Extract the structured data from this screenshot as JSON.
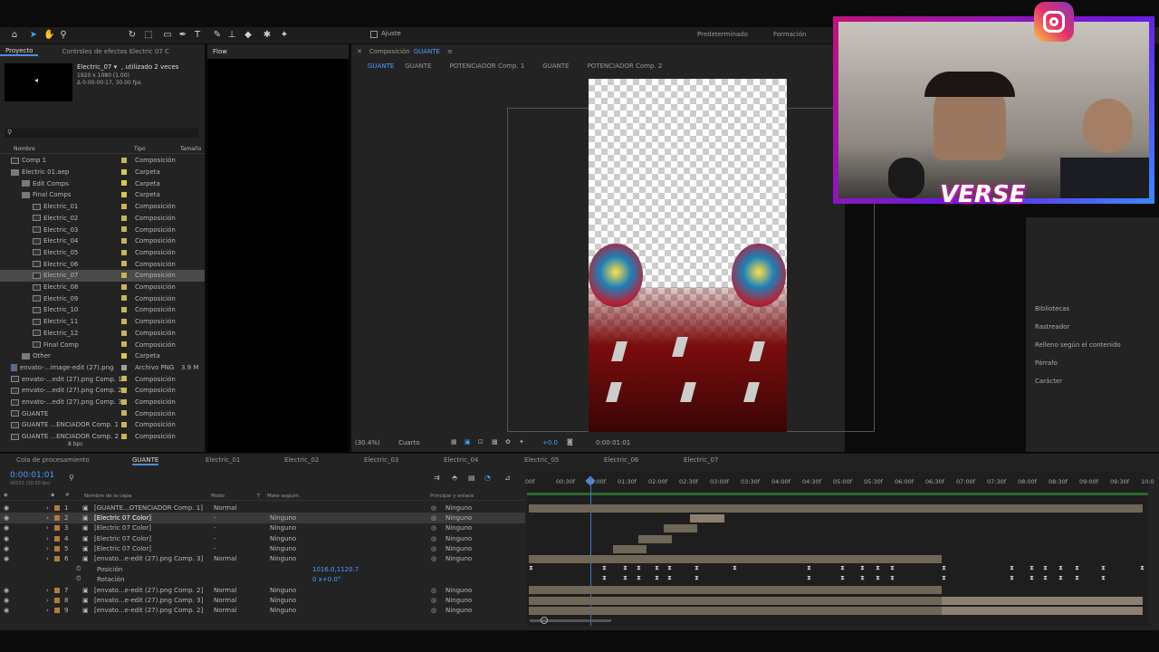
{
  "toolbar": {
    "ajuste_label": "Ajuste",
    "workspace1": "Predeterminado",
    "workspace2": "Formación"
  },
  "project_panel": {
    "tabs": [
      "Proyecto",
      "Controles de efectos Electric 07 C"
    ],
    "flow_tab": "Flow",
    "item_name": "Electric_07 ▾",
    "item_usage": ", utilizado 2 veces",
    "item_dims": "1920 x 1080 (1.00)",
    "item_duration": "Δ 0:00:00:17, 30.00 fps",
    "columns": {
      "name": "Nombre",
      "type": "Tipo",
      "size": "Tamaño"
    },
    "bpc": "8 bpc",
    "rows": [
      {
        "name": "Comp 1",
        "type": "Composición",
        "size": "",
        "icon": "comp",
        "indent": 0,
        "color": "#c8b45a"
      },
      {
        "name": "Electric 01.aep",
        "type": "Carpeta",
        "size": "",
        "icon": "folder",
        "indent": 0,
        "color": "#d6c84a"
      },
      {
        "name": "Edit Comps",
        "type": "Carpeta",
        "size": "",
        "icon": "folder",
        "indent": 1,
        "color": "#d6c84a"
      },
      {
        "name": "Final Comps",
        "type": "Carpeta",
        "size": "",
        "icon": "folder",
        "indent": 1,
        "color": "#d6c84a"
      },
      {
        "name": "Electric_01",
        "type": "Composición",
        "size": "",
        "icon": "comp",
        "indent": 2,
        "color": "#c8b45a"
      },
      {
        "name": "Electric_02",
        "type": "Composición",
        "size": "",
        "icon": "comp",
        "indent": 2,
        "color": "#c8b45a"
      },
      {
        "name": "Electric_03",
        "type": "Composición",
        "size": "",
        "icon": "comp",
        "indent": 2,
        "color": "#c8b45a"
      },
      {
        "name": "Electric_04",
        "type": "Composición",
        "size": "",
        "icon": "comp",
        "indent": 2,
        "color": "#c8b45a"
      },
      {
        "name": "Electric_05",
        "type": "Composición",
        "size": "",
        "icon": "comp",
        "indent": 2,
        "color": "#c8b45a"
      },
      {
        "name": "Electric_06",
        "type": "Composición",
        "size": "",
        "icon": "comp",
        "indent": 2,
        "color": "#c8b45a"
      },
      {
        "name": "Electric_07",
        "type": "Composición",
        "size": "",
        "icon": "comp",
        "indent": 2,
        "color": "#c8b45a",
        "selected": true
      },
      {
        "name": "Electric_08",
        "type": "Composición",
        "size": "",
        "icon": "comp",
        "indent": 2,
        "color": "#c8b45a"
      },
      {
        "name": "Electric_09",
        "type": "Composición",
        "size": "",
        "icon": "comp",
        "indent": 2,
        "color": "#c8b45a"
      },
      {
        "name": "Electric_10",
        "type": "Composición",
        "size": "",
        "icon": "comp",
        "indent": 2,
        "color": "#c8b45a"
      },
      {
        "name": "Electric_11",
        "type": "Composición",
        "size": "",
        "icon": "comp",
        "indent": 2,
        "color": "#c8b45a"
      },
      {
        "name": "Electric_12",
        "type": "Composición",
        "size": "",
        "icon": "comp",
        "indent": 2,
        "color": "#c8b45a"
      },
      {
        "name": "Final Comp",
        "type": "Composición",
        "size": "",
        "icon": "comp",
        "indent": 2,
        "color": "#c8b45a"
      },
      {
        "name": "Other",
        "type": "Carpeta",
        "size": "",
        "icon": "folder",
        "indent": 1,
        "color": "#d6c84a"
      },
      {
        "name": "envato-...image-edit (27).png",
        "type": "Archivo PNG",
        "size": "3.9 M",
        "icon": "png",
        "indent": 0,
        "color": "#a0a0a0"
      },
      {
        "name": "envato-...edit (27).png Comp. 1",
        "type": "Composición",
        "size": "",
        "icon": "comp",
        "indent": 0,
        "color": "#c8b45a"
      },
      {
        "name": "envato-...edit (27).png Comp. 2",
        "type": "Composición",
        "size": "",
        "icon": "comp",
        "indent": 0,
        "color": "#c8b45a"
      },
      {
        "name": "envato-...edit (27).png Comp. 3",
        "type": "Composición",
        "size": "",
        "icon": "comp",
        "indent": 0,
        "color": "#c8b45a"
      },
      {
        "name": "GUANTE",
        "type": "Composición",
        "size": "",
        "icon": "comp",
        "indent": 0,
        "color": "#c8b45a"
      },
      {
        "name": "GUANTE ...ENCIADOR Comp. 1",
        "type": "Composición",
        "size": "",
        "icon": "comp",
        "indent": 0,
        "color": "#c8b45a"
      },
      {
        "name": "GUANTE ...ENCIADOR Comp. 2",
        "type": "Composición",
        "size": "",
        "icon": "comp",
        "indent": 0,
        "color": "#c8b45a"
      }
    ]
  },
  "composition": {
    "header_prefix": "Composición",
    "header_name": "GUANTE",
    "breadcrumbs": [
      "GUANTE",
      "GUANTE",
      "POTENCIADOR Comp. 1",
      "GUANTE",
      "POTENCIADOR Comp. 2"
    ],
    "zoom": "(30.4%)",
    "resolution": "Cuarto",
    "exposure": "+0.0",
    "timecode": "0:00:01:01"
  },
  "right_panel": {
    "items": [
      "Bibliotecas",
      "Rastreador",
      "Relleno según el contenido",
      "Párrafo",
      "Carácter"
    ]
  },
  "webcam": {
    "overlay_text": "VERSE"
  },
  "timeline": {
    "tabs": [
      "Cola de procesamiento",
      "GUANTE",
      "Electric_01",
      "Electric_02",
      "Electric_03",
      "Electric_04",
      "Electric_05",
      "Electric_06",
      "Electric_07"
    ],
    "timecode": "0:00:01:01",
    "subtime": "00031 (30.00 fps)",
    "columns": {
      "layer_name": "Nombre de la capa",
      "mode": "Modo",
      "t": "T",
      "matte": "Mate seguim.",
      "parent": "Principal y enlace"
    },
    "ruler": [
      "00f",
      "00:30f",
      "01:00f",
      "01:30f",
      "02:00f",
      "02:30f",
      "03:00f",
      "03:30f",
      "04:00f",
      "04:30f",
      "05:00f",
      "05:30f",
      "06:00f",
      "06:30f",
      "07:00f",
      "07:30f",
      "08:00f",
      "08:30f",
      "09:00f",
      "09:30f",
      "10:0"
    ],
    "layers": [
      {
        "num": "1",
        "name": "[GUANTE...OTENCIADOR Comp. 1]",
        "mode": "Normal",
        "matte": "",
        "parent": "Ninguno"
      },
      {
        "num": "2",
        "name": "[Electric 07 Color]",
        "mode": "-",
        "matte": "Ninguno",
        "parent": "Ninguno",
        "selected": true
      },
      {
        "num": "3",
        "name": "[Electric 07 Color]",
        "mode": "-",
        "matte": "Ninguno",
        "parent": "Ninguno"
      },
      {
        "num": "4",
        "name": "[Electric 07 Color]",
        "mode": "-",
        "matte": "Ninguno",
        "parent": "Ninguno"
      },
      {
        "num": "5",
        "name": "[Electric 07 Color]",
        "mode": "-",
        "matte": "Ninguno",
        "parent": "Ninguno"
      },
      {
        "num": "6",
        "name": "[envato...e-edit (27).png Comp. 3]",
        "mode": "Normal",
        "matte": "Ninguno",
        "parent": "Ninguno"
      }
    ],
    "props": [
      {
        "name": "Posición",
        "value": "1016.0,1120.7"
      },
      {
        "name": "Rotación",
        "value": "0 x+0.0°"
      }
    ],
    "layers2": [
      {
        "num": "7",
        "name": "[envato...e-edit (27).png Comp. 2]",
        "mode": "Normal",
        "matte": "Ninguno",
        "parent": "Ninguno"
      },
      {
        "num": "8",
        "name": "[envato...e-edit (27).png Comp. 3]",
        "mode": "Normal",
        "matte": "Ninguno",
        "parent": "Ninguno"
      },
      {
        "num": "9",
        "name": "[envato...e-edit (27).png Comp. 2]",
        "mode": "Normal",
        "matte": "Ninguno",
        "parent": "Ninguno"
      }
    ]
  }
}
